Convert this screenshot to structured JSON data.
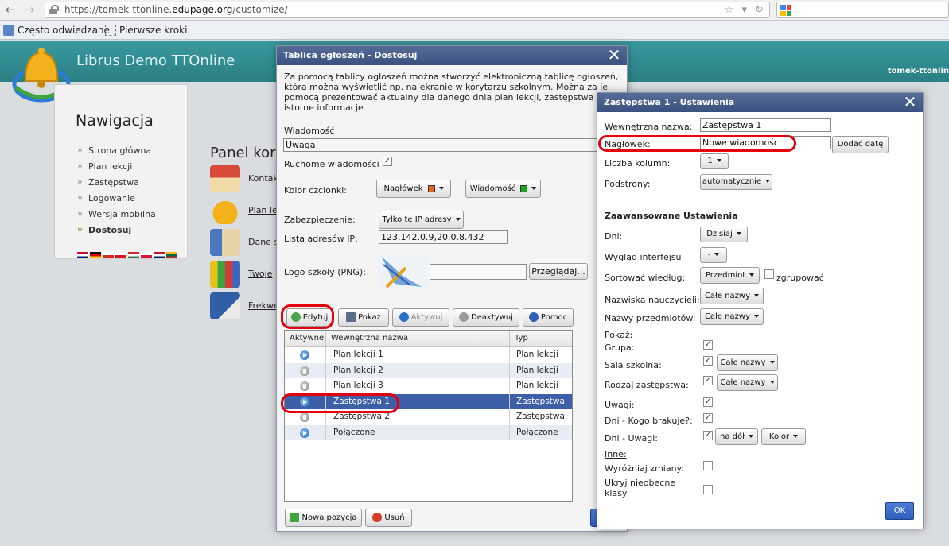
{
  "browser": {
    "url_prefix": "https://tomek-ttonline.",
    "url_domain": "edupage.org",
    "url_path": "/customize/",
    "bookmarks": [
      "Często odwiedzane",
      "Pierwsze kroki"
    ]
  },
  "site": {
    "title": "Librus Demo TTOnline",
    "user": "tomek-ttonlin",
    "nav_title": "Nawigacja",
    "nav_items": [
      "Strona główna",
      "Plan lekcji",
      "Zastępstwa",
      "Logowanie",
      "Wersja mobilna",
      "Dostosuj"
    ],
    "panel_title": "Panel kor",
    "panel_items": [
      "Kontak",
      "Plan le",
      "Dane s",
      "Twoje",
      "Frekwe"
    ]
  },
  "dialog1": {
    "title": "Tablica ogłoszeń - Dostosuj",
    "intro": "Za pomocą tablicy ogłoszeń można stworzyć elektroniczną tablicę ogłoszeń, którą można wyświetlić np. na ekranie w korytarzu szkolnym. Można za jej pomocą prezentować aktualny dla danego dnia plan lekcji, zastępstwa inne istotne informacje.",
    "message_label": "Wiadomość",
    "message_value": "Uwaga",
    "moving_label": "Ruchome wiadomości",
    "font_color_label": "Kolor czcionki:",
    "header_btn": "Nagłówek",
    "message_btn": "Wiadomość",
    "security_label": "Zabezpieczenie:",
    "security_value": "Tylko te IP adresy",
    "ip_label": "Lista adresów IP:",
    "ip_value": "123.142.0.9,20.0.8.432",
    "logo_label": "Logo szkoły (PNG):",
    "browse_btn": "Przeglądaj...",
    "toolbar": {
      "edit": "Edytuj",
      "show": "Pokaż",
      "activate": "Aktywuj",
      "deactivate": "Deaktywuj",
      "help": "Pomoc"
    },
    "table": {
      "headers": [
        "Aktywne",
        "Wewnętrzna nazwa",
        "Typ"
      ],
      "rows": [
        {
          "name": "Plan lekcji 1",
          "type": "Plan lekcji"
        },
        {
          "name": "Plan lekcji 2",
          "type": "Plan lekcji"
        },
        {
          "name": "Plan lekcji 3",
          "type": "Plan lekcji"
        },
        {
          "name": "Zastępstwa 1",
          "type": "Zastępstwa"
        },
        {
          "name": "Zastępstwa 2",
          "type": "Zastępstwa"
        },
        {
          "name": "Połączone",
          "type": "Połączone"
        }
      ]
    },
    "new_btn": "Nowa pozycja",
    "delete_btn": "Usuń"
  },
  "dialog2": {
    "title": "Zastępstwa 1 - Ustawienia",
    "internal_name_label": "Wewnętrzna nazwa:",
    "internal_name_value": "Zastępstwa 1",
    "header_label": "Nagłówek:",
    "header_value": "Nowe wiadomości",
    "add_date_btn": "Dodać datę",
    "columns_label": "Liczba kolumn:",
    "columns_value": "1",
    "subpages_label": "Podstrony:",
    "subpages_value": "automatycznie",
    "advanced_title": "Zaawansowane Ustawienia",
    "days_label": "Dni:",
    "days_value": "Dzisiaj",
    "look_label": "Wygląd interfejsu",
    "look_value": "-",
    "sort_label": "Sortować wiedług:",
    "sort_value": "Przedmiot",
    "group_label": "zgrupować",
    "teachers_label": "Nazwiska nauczycieli:",
    "teachers_value": "Całe nazwy",
    "subjects_label": "Nazwy przedmiotów:",
    "subjects_value": "Całe nazwy",
    "show_label": "Pokaż:",
    "group_show_label": "Grupa:",
    "room_label": "Sala szkolna:",
    "room_value": "Całe nazwy",
    "sub_type_label": "Rodzaj zastępstwa:",
    "sub_type_value": "Całe nazwy",
    "notes_label": "Uwagi:",
    "missing_label": "Dni - Kogo brakuje?:",
    "day_notes_label": "Dni - Uwagi:",
    "day_notes_value": "na dół",
    "color_value": "Kolor",
    "other_label": "Inne:",
    "highlight_label": "Wyróżniaj zmiany:",
    "hide_label": "Ukryj nieobecne klasy:",
    "ok_btn": "OK"
  },
  "colors": {
    "header_swatch": "#e2661e",
    "message_swatch": "#1aa81a",
    "highlight_ring": "#e3000f",
    "selected_row": "#3d5fa8"
  }
}
